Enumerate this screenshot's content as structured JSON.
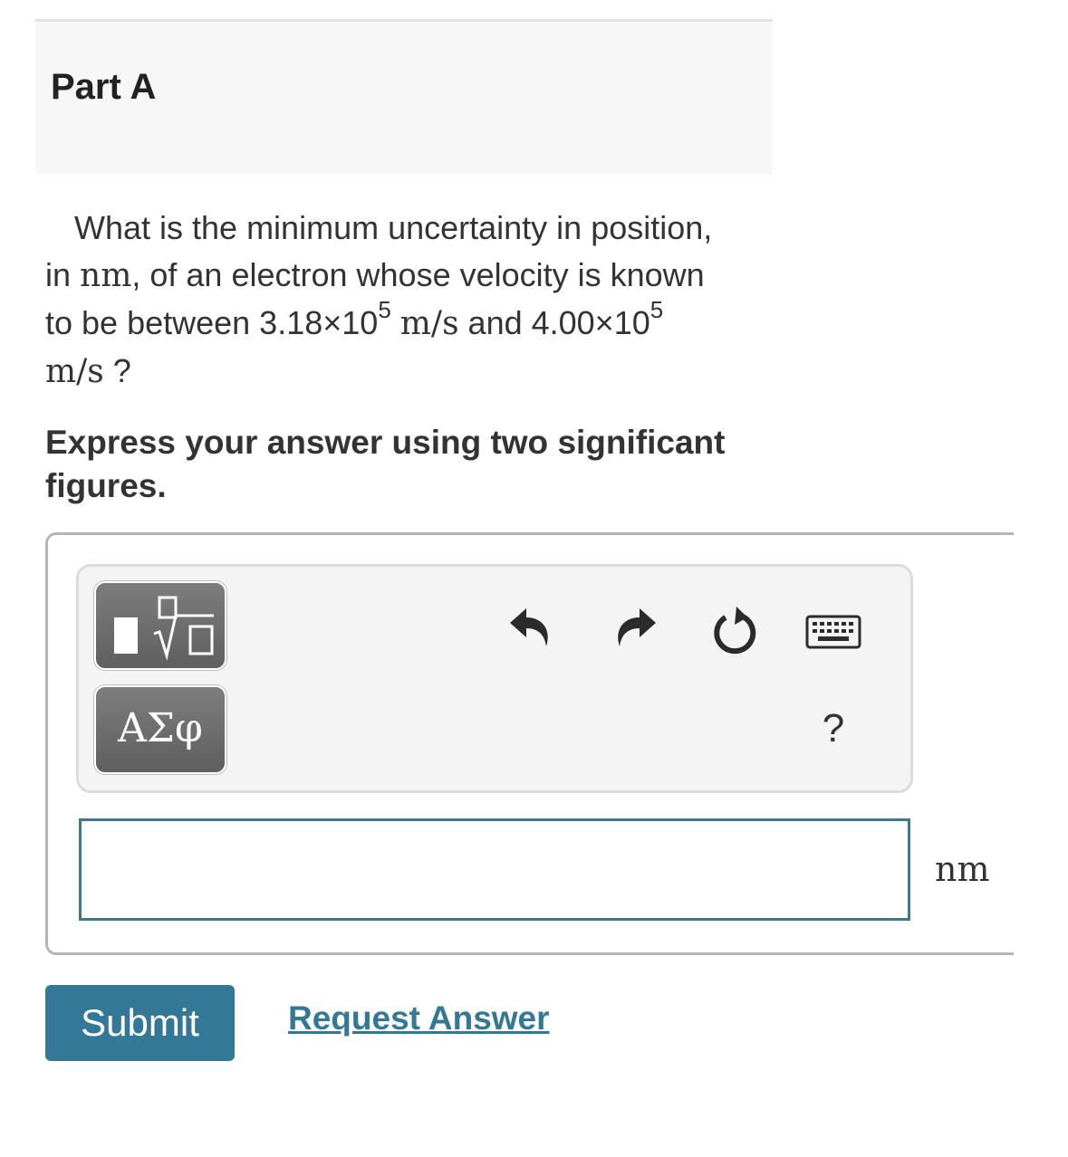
{
  "part": {
    "title": "Part A"
  },
  "question": {
    "line1": "What is the minimum uncertainty in position,",
    "in_word": "in",
    "unit_nm": "nm",
    "line2_rest": ", of an electron whose velocity is known",
    "line3_start": "to be between 3.18×10",
    "exp1": "5",
    "unit_ms": "m/s",
    "and_word": " and 4.00×10",
    "exp2": "5",
    "question_mark": " ?"
  },
  "instruction": "Express your answer using two significant figures.",
  "toolbar": {
    "templates_icon": "templates-sqrt-icon",
    "greek_label": "ΑΣφ",
    "undo_icon": "undo-icon",
    "redo_icon": "redo-icon",
    "reset_icon": "reset-icon",
    "keyboard_icon": "keyboard-icon",
    "help_label": "?"
  },
  "answer": {
    "value": "",
    "unit": "nm"
  },
  "actions": {
    "submit_label": "Submit",
    "request_label": "Request Answer"
  },
  "colors": {
    "accent": "#347898",
    "input_border": "#3d7791"
  }
}
